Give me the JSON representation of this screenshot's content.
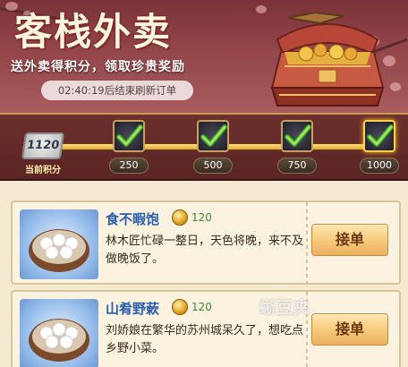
{
  "header": {
    "title": "客栈外卖",
    "subtitle": "送外卖得积分，领取珍贵奖励",
    "timer": "02:40:19后结束刷新订单"
  },
  "progress": {
    "current_points": "1120",
    "current_label": "当前积分",
    "milestones": [
      {
        "value": "250",
        "claimed": true
      },
      {
        "value": "500",
        "claimed": true
      },
      {
        "value": "750",
        "claimed": true
      },
      {
        "value": "1000",
        "claimed": true
      }
    ]
  },
  "orders": [
    {
      "title": "食不暇饱",
      "reward": "120",
      "description": "林木匠忙碌一整日，天色将晚，来不及做晚饭了。",
      "button": "接单"
    },
    {
      "title": "山肴野蔌",
      "reward": "120",
      "description": "刘娇娘在繁华的苏州城呆久了，想吃点乡野小菜。",
      "button": "接单"
    }
  ],
  "watermark": "蜥豆夹",
  "colors": {
    "banner": "#93464a",
    "accent_gold": "#ffd24a",
    "order_title": "#2a5fb0",
    "reward_green": "#3a8a3a",
    "button": "#f7c87a"
  },
  "icons": [
    "treasure-box-icon",
    "check-icon",
    "coin-icon",
    "dumpling-bowl-icon"
  ]
}
